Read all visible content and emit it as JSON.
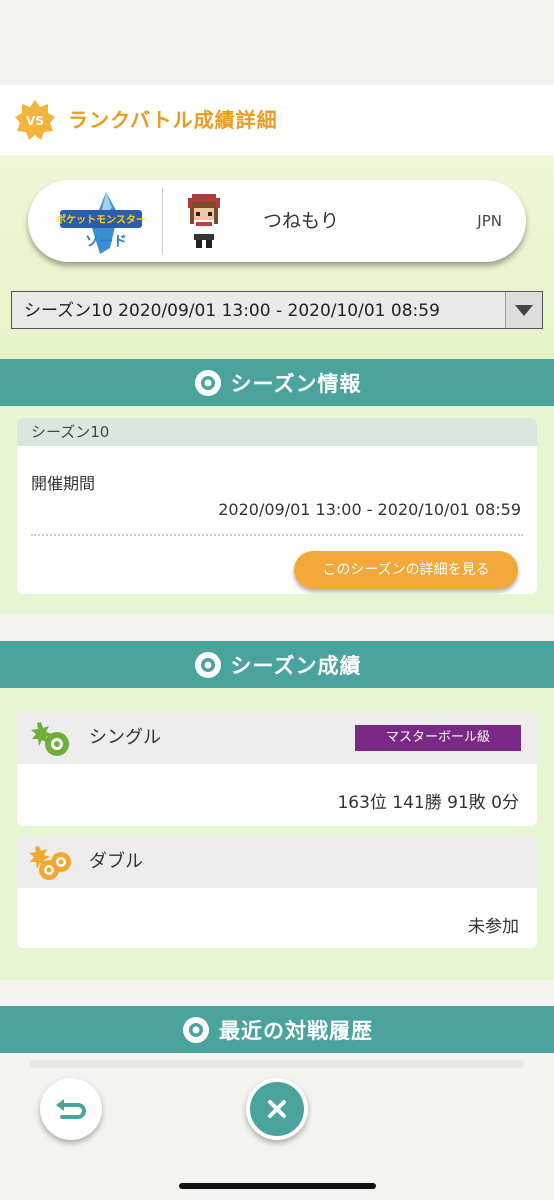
{
  "header": {
    "badge": "VS",
    "title": "ランクバトル成績詳細"
  },
  "player": {
    "name": "つねもり",
    "region": "JPN",
    "game_logo_text": "ポケットモンスター ソード"
  },
  "season_select": {
    "selected": "シーズン10 2020/09/01 13:00 - 2020/10/01 08:59"
  },
  "season_info": {
    "section_title": "シーズン情報",
    "season_name": "シーズン10",
    "period_label": "開催期間",
    "period_value": "2020/09/01 13:00 - 2020/10/01 08:59",
    "detail_button": "このシーズンの詳細を見る"
  },
  "season_record": {
    "section_title": "シーズン成績",
    "single": {
      "title": "シングル",
      "rank_badge": "マスターボール級",
      "result": "163位 141勝 91敗 0分"
    },
    "double": {
      "title": "ダブル",
      "result": "未参加"
    }
  },
  "history": {
    "section_title": "最近の対戦履歴"
  },
  "colors": {
    "accent_teal": "#4aa39d",
    "accent_orange": "#f3a83a",
    "badge_purple": "#7a2a86",
    "title_orange": "#ef9a1c"
  },
  "icons": [
    "vs-star-icon",
    "pokeball-icon",
    "back-arrow-icon",
    "close-icon"
  ]
}
